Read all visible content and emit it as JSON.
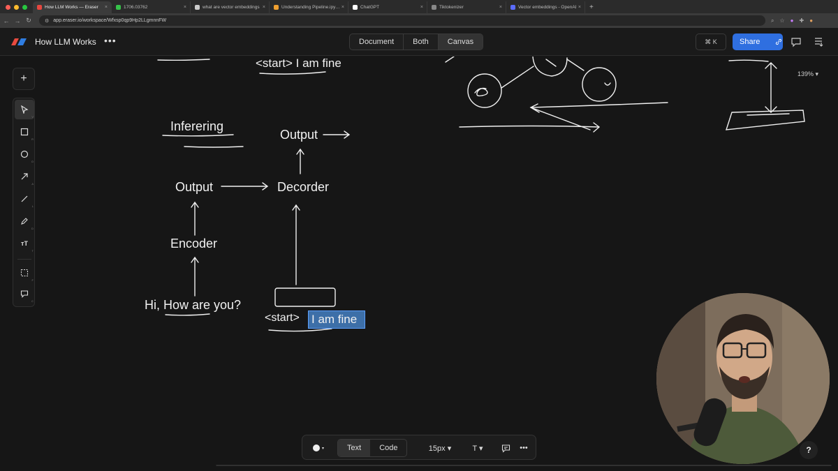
{
  "browser": {
    "tabs": [
      {
        "label": "How LLM Works — Eraser",
        "fav": "#e8473f",
        "active": true
      },
      {
        "label": "1706.03762",
        "fav": "#36c24a",
        "active": false
      },
      {
        "label": "what are vector embeddings",
        "fav": "#cccccc",
        "active": false
      },
      {
        "label": "Understanding Pipeline.ipynb",
        "fav": "#f0a030",
        "active": false
      },
      {
        "label": "ChatGPT",
        "fav": "#ffffff",
        "active": false
      },
      {
        "label": "Tiktokenizer",
        "fav": "#888888",
        "active": false
      },
      {
        "label": "Vector embeddings - OpenAI",
        "fav": "#5b6cff",
        "active": false
      }
    ],
    "new_tab": "+",
    "url": "app.eraser.io/workspace/Wfxsp0qp9Hp2LLgmnnFW"
  },
  "header": {
    "doc_title": "How LLM Works",
    "more": "•••",
    "views": [
      "Document",
      "Both",
      "Canvas"
    ],
    "active_view": "Canvas",
    "cmd_k": "⌘ K",
    "share": "Share"
  },
  "toolbar": {
    "add": "+",
    "tools": [
      {
        "name": "select-tool",
        "key": "V"
      },
      {
        "name": "rectangle-tool",
        "key": "R"
      },
      {
        "name": "ellipse-tool",
        "key": "O"
      },
      {
        "name": "arrow-tool",
        "key": "A"
      },
      {
        "name": "line-tool",
        "key": "L"
      },
      {
        "name": "pen-tool",
        "key": "D"
      },
      {
        "name": "text-tool",
        "key": "T"
      },
      {
        "name": "frame-tool",
        "key": "F"
      },
      {
        "name": "comment-tool",
        "key": "C"
      }
    ]
  },
  "canvas": {
    "zoom": "139% ▾",
    "top_text": "<start> I am fine",
    "inferering": "Inferering",
    "output_top": "Output",
    "output_left": "Output",
    "decorder": "Decorder",
    "encoder": "Encoder",
    "input": "Hi, How are you?",
    "start_token": "<start>",
    "selected_text": "I am fine"
  },
  "bottom_toolbar": {
    "modes": [
      "Text",
      "Code"
    ],
    "active_mode": "Text",
    "font_size": "15px ▾",
    "text_style": "T ▾",
    "more": "•••"
  },
  "help": "?"
}
